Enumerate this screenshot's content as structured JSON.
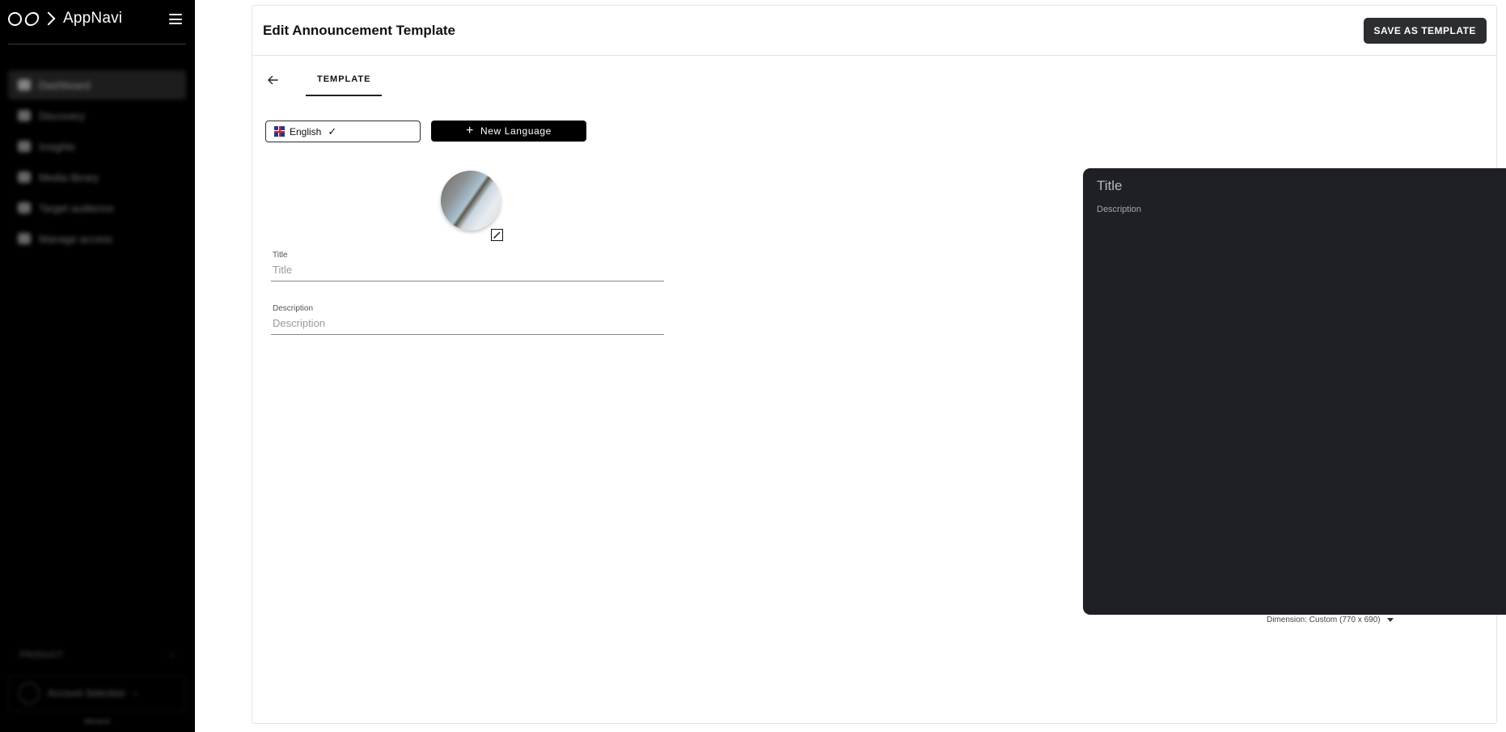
{
  "sidebar": {
    "brand": "AppNavi",
    "nav_items": [
      {
        "label": "Dashboard",
        "icon": "grid-icon",
        "active": true
      },
      {
        "label": "Discovery",
        "icon": "search-icon"
      },
      {
        "label": "Insights",
        "icon": "chart-icon"
      },
      {
        "label": "Media library",
        "icon": "image-icon"
      },
      {
        "label": "Target audience",
        "icon": "users-icon"
      },
      {
        "label": "Manage access",
        "icon": "lock-icon"
      }
    ],
    "product_label": "PRODUCT",
    "account_name": "Account Selection",
    "version": "Version"
  },
  "header": {
    "title": "Edit Announcement Template",
    "save_label": "SAVE AS TEMPLATE"
  },
  "tabs": {
    "template_label": "TEMPLATE"
  },
  "language": {
    "current": "English",
    "new_label": "New Language"
  },
  "form": {
    "title_label": "Title",
    "title_placeholder": "Title",
    "title_value": "",
    "description_label": "Description",
    "description_placeholder": "Description",
    "description_value": ""
  },
  "preview": {
    "title": "Title",
    "description": "Description",
    "dimension": "Dimension: Custom (770 x 690)",
    "background_color": "#1f2025"
  },
  "colors": {
    "sidebar_bg": "#000000",
    "primary_button": "#2c2d31"
  }
}
